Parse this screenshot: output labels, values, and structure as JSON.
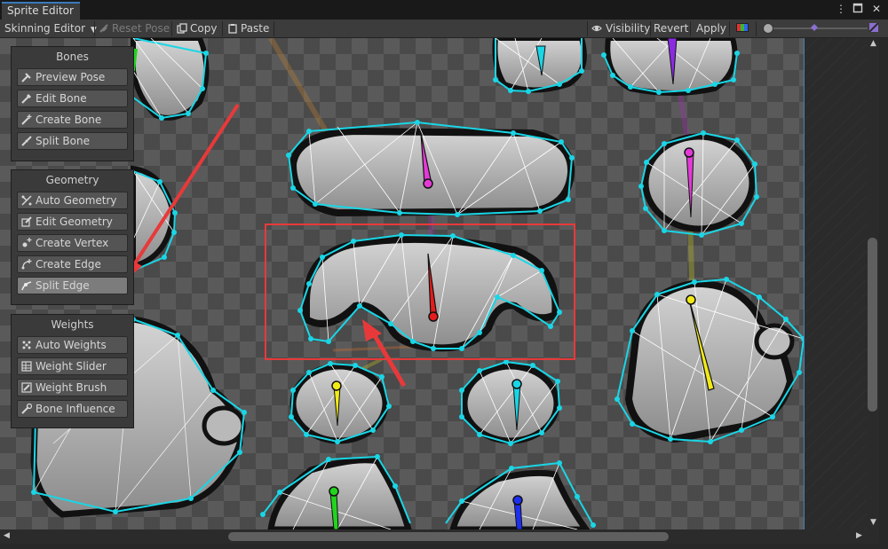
{
  "window": {
    "tab_title": "Sprite Editor",
    "menu_icon": "kebab-menu-icon",
    "maximize_icon": "maximize-icon",
    "close_icon": "close-icon"
  },
  "toolbar": {
    "mode_dropdown": "Skinning Editor",
    "reset_pose": "Reset Pose",
    "copy": "Copy",
    "paste": "Paste",
    "visibility": "Visibility",
    "revert": "Revert",
    "apply": "Apply",
    "color_toggle_icon": "color-channels-icon"
  },
  "panels": {
    "bones": {
      "title": "Bones",
      "buttons": [
        {
          "label": "Preview Pose",
          "icon": "preview-pose-icon"
        },
        {
          "label": "Edit Bone",
          "icon": "edit-bone-icon"
        },
        {
          "label": "Create Bone",
          "icon": "create-bone-icon"
        },
        {
          "label": "Split Bone",
          "icon": "split-bone-icon"
        }
      ]
    },
    "geometry": {
      "title": "Geometry",
      "buttons": [
        {
          "label": "Auto Geometry",
          "icon": "auto-geometry-icon"
        },
        {
          "label": "Edit Geometry",
          "icon": "edit-geometry-icon"
        },
        {
          "label": "Create Vertex",
          "icon": "create-vertex-icon"
        },
        {
          "label": "Create Edge",
          "icon": "create-edge-icon"
        },
        {
          "label": "Split Edge",
          "icon": "split-edge-icon"
        }
      ]
    },
    "weights": {
      "title": "Weights",
      "buttons": [
        {
          "label": "Auto Weights",
          "icon": "auto-weights-icon"
        },
        {
          "label": "Weight Slider",
          "icon": "weight-slider-icon"
        },
        {
          "label": "Weight Brush",
          "icon": "weight-brush-icon"
        },
        {
          "label": "Bone Influence",
          "icon": "bone-influence-icon"
        }
      ]
    }
  },
  "colors": {
    "mesh_outline": "#19d6e6",
    "annotation": "#e8393a",
    "bone_magenta": "#e33ad6",
    "bone_red": "#e41c1c",
    "bone_yellow": "#f2ea17",
    "bone_cyan": "#19d6e6",
    "bone_green": "#22d41e",
    "bone_blue": "#1d2ef0",
    "bone_purple": "#8a2be2"
  }
}
